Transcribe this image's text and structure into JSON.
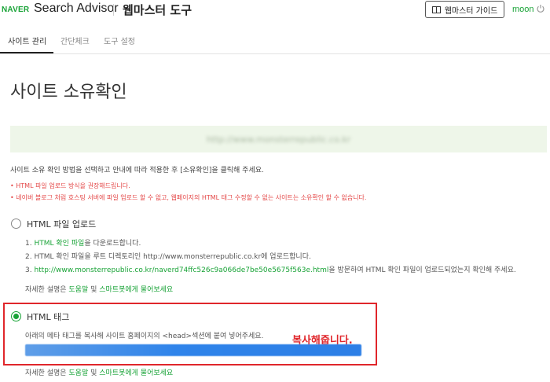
{
  "header": {
    "brand_naver": "NAVER",
    "brand_name": "Search Advisor",
    "tool_name": "웹마스터 도구",
    "guide_button": "웹마스터 가이드",
    "user": "moon"
  },
  "tabs": [
    {
      "label": "사이트 관리",
      "active": true
    },
    {
      "label": "간단체크",
      "active": false
    },
    {
      "label": "도구 설정",
      "active": false
    }
  ],
  "page_title": "사이트 소유확인",
  "site_url": "http://www.monsterrepublic.co.kr",
  "instruction": "사이트 소유 확인 방법을 선택하고 안내에 따라 적용한 후 [소유확인]을 클릭해 주세요.",
  "notes": [
    "• HTML 파일 업로드 방식을 권장해드립니다.",
    "• 네이버 블로그 처럼 호스팅 서버에 파일 업로드 할 수 없고, 웹페이지의 HTML 태그 수정할 수 없는 사이트는 소유확인 할 수 없습니다."
  ],
  "option_upload": {
    "title": "HTML 파일 업로드",
    "step1_prefix": "1. ",
    "step1_link": "HTML 확인 파일",
    "step1_suffix": "을 다운로드합니다.",
    "step2": "2. HTML 확인 파일을 루트 디렉토리인 http://www.monsterrepublic.co.kr에 업로드합니다.",
    "step3_prefix": "3. ",
    "step3_link": "http://www.monsterrepublic.co.kr/naverd74ffc526c9a066de7be50e5675f563e.html",
    "step3_suffix": "을 방문하여 HTML 확인 파일이 업로드되었는지 확인해 주세요.",
    "help_prefix": "자세한 설명은 ",
    "help_link1": "도움말",
    "help_mid": " 및 ",
    "help_link2": "스마트봇에게 물어보세요"
  },
  "option_tag": {
    "title": "HTML 태그",
    "selected": true,
    "description": "아래의 메타 태그를 복사해 사이트 홈페이지의 <head>섹션에 붙여 넣어주세요.",
    "annotation": "복사해줍니다.",
    "help_prefix": "자세한 설명은 ",
    "help_link1": "도움말",
    "help_mid": " 및 ",
    "help_link2": "스마트봇에게 물어보세요"
  },
  "colors": {
    "accent": "#19a337",
    "warning": "#e44848",
    "highlight_border": "#e0262b",
    "meta_tag_bar": "#2f84ea"
  }
}
